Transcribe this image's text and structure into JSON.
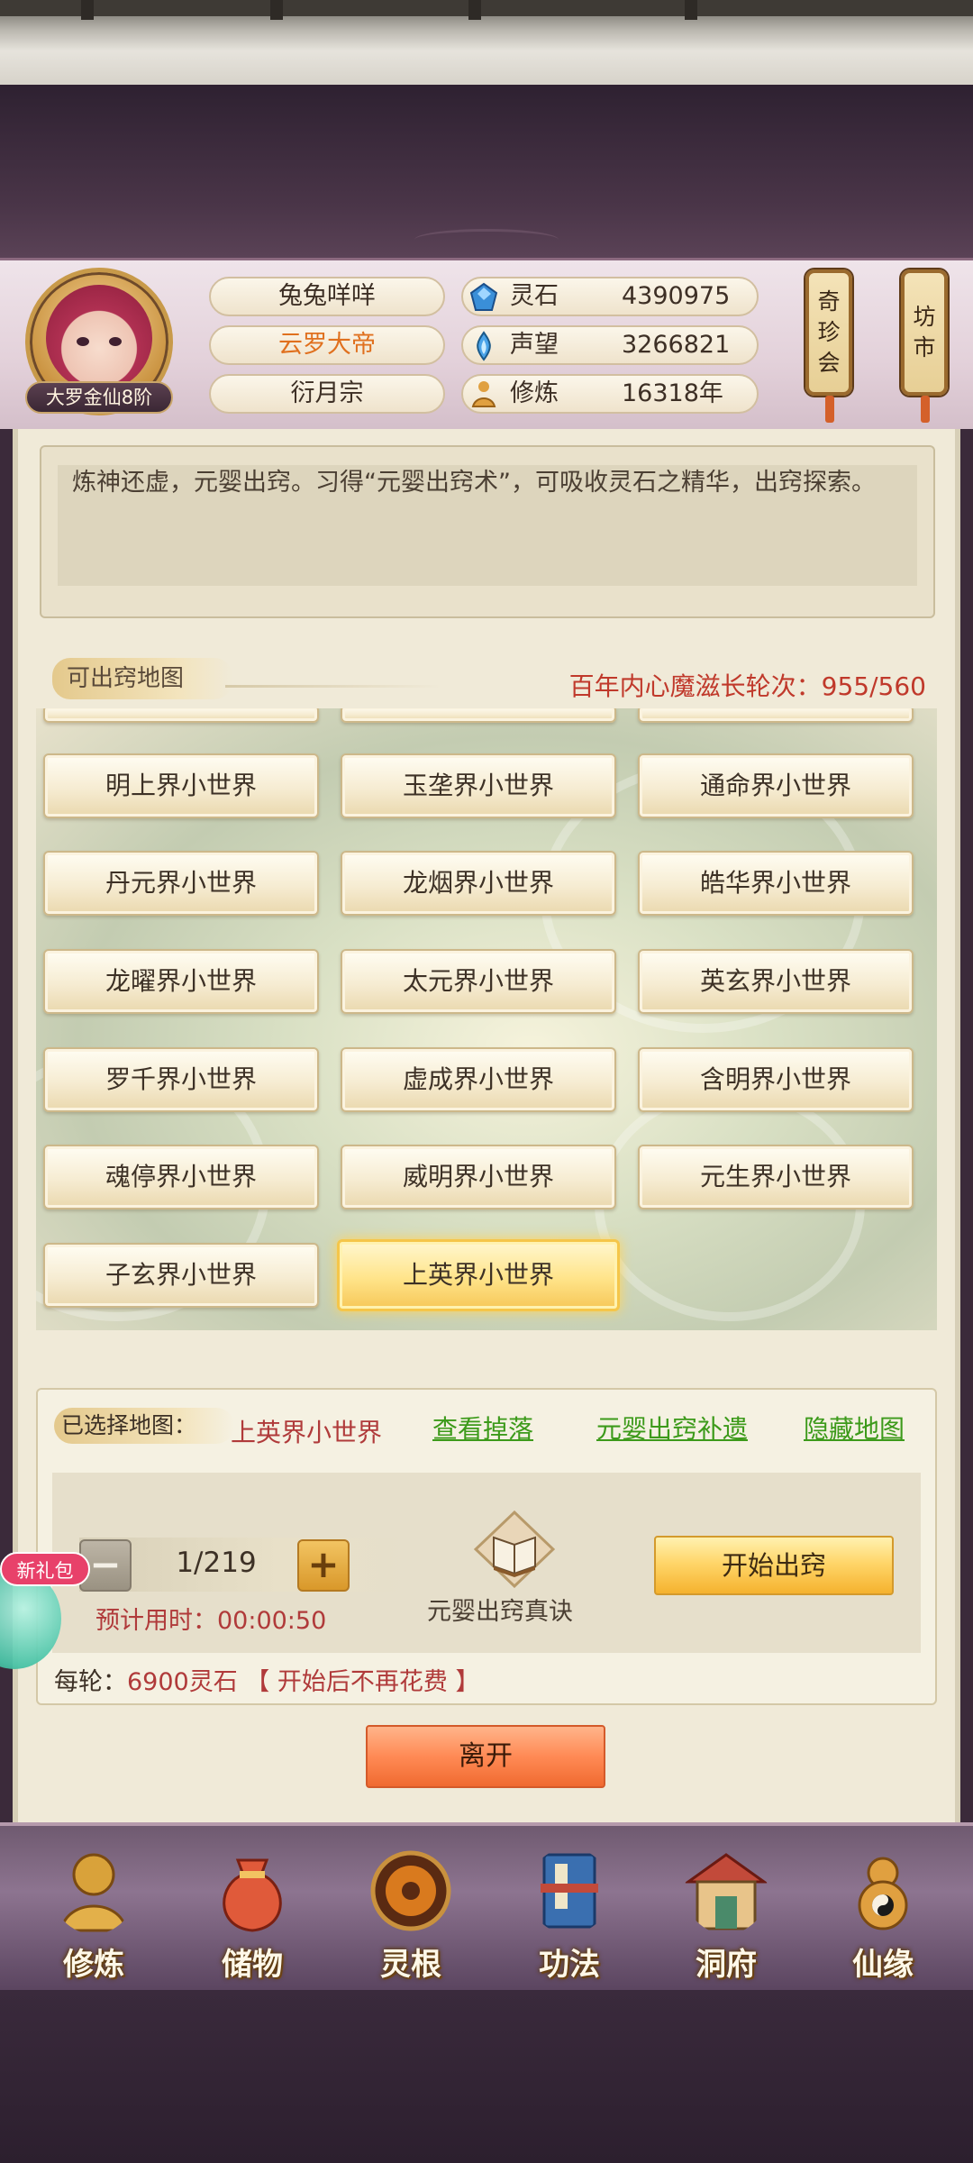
{
  "player": {
    "name": "兔兔咩咩",
    "title": "云罗大帝",
    "sect": "衍月宗",
    "rank": "大罗金仙8阶"
  },
  "stats": [
    {
      "icon": "spirit-stone-icon",
      "label": "灵石",
      "value": "4390975"
    },
    {
      "icon": "prestige-icon",
      "label": "声望",
      "value": "3266821"
    },
    {
      "icon": "cultivation-icon",
      "label": "修炼",
      "value": "16318年"
    }
  ],
  "lanterns": {
    "treasure": [
      "奇",
      "珍",
      "会"
    ],
    "market": [
      "坊",
      "市"
    ]
  },
  "description": "炼神还虚，元婴出窍。习得“元婴出窍术”，可吸收灵石之精华，出窍探索。",
  "maps_section": {
    "title": "可出窍地图",
    "round_info": "百年内心魔滋长轮次：955/560",
    "maps": [
      "明上界小世界",
      "玉垄界小世界",
      "通命界小世界",
      "丹元界小世界",
      "龙烟界小世界",
      "皓华界小世界",
      "龙曜界小世界",
      "太元界小世界",
      "英玄界小世界",
      "罗千界小世界",
      "虚成界小世界",
      "含明界小世界",
      "魂停界小世界",
      "威明界小世界",
      "元生界小世界",
      "子玄界小世界",
      "上英界小世界"
    ],
    "selected_map": "上英界小世界"
  },
  "selection": {
    "label": "已选择地图：",
    "map_name": "上英界小世界",
    "links": [
      "查看掉落",
      "元婴出窍补遗",
      "隐藏地图"
    ],
    "count": "1/219",
    "minus": "−",
    "plus": "+",
    "eta": "预计用时：00:00:50",
    "item_label": "元婴出窍真诀",
    "start_button": "开始出窍",
    "cost_prefix": "每轮：",
    "cost_value": "6900灵石 【 开始后不再花费 】"
  },
  "leave_button": "离开",
  "gift_badge": "新礼包",
  "bottom_nav": [
    {
      "label": "修炼",
      "icon": "meditation-icon",
      "color": "#d9a23a"
    },
    {
      "label": "储物",
      "icon": "storage-bag-icon",
      "color": "#e05a3a"
    },
    {
      "label": "灵根",
      "icon": "spirit-root-icon",
      "color": "#b8631e"
    },
    {
      "label": "功法",
      "icon": "scripture-icon",
      "color": "#3a6fb0"
    },
    {
      "label": "洞府",
      "icon": "cave-house-icon",
      "color": "#c24a3a"
    },
    {
      "label": "仙缘",
      "icon": "gourd-icon",
      "color": "#e0a040"
    }
  ]
}
